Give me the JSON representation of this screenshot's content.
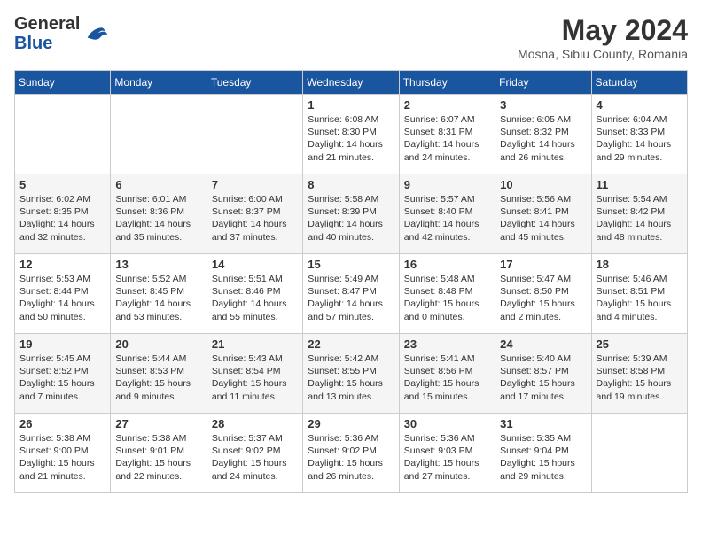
{
  "header": {
    "logo_general": "General",
    "logo_blue": "Blue",
    "month_year": "May 2024",
    "location": "Mosna, Sibiu County, Romania"
  },
  "weekdays": [
    "Sunday",
    "Monday",
    "Tuesday",
    "Wednesday",
    "Thursday",
    "Friday",
    "Saturday"
  ],
  "weeks": [
    [
      {
        "day": "",
        "info": ""
      },
      {
        "day": "",
        "info": ""
      },
      {
        "day": "",
        "info": ""
      },
      {
        "day": "1",
        "info": "Sunrise: 6:08 AM\nSunset: 8:30 PM\nDaylight: 14 hours\nand 21 minutes."
      },
      {
        "day": "2",
        "info": "Sunrise: 6:07 AM\nSunset: 8:31 PM\nDaylight: 14 hours\nand 24 minutes."
      },
      {
        "day": "3",
        "info": "Sunrise: 6:05 AM\nSunset: 8:32 PM\nDaylight: 14 hours\nand 26 minutes."
      },
      {
        "day": "4",
        "info": "Sunrise: 6:04 AM\nSunset: 8:33 PM\nDaylight: 14 hours\nand 29 minutes."
      }
    ],
    [
      {
        "day": "5",
        "info": "Sunrise: 6:02 AM\nSunset: 8:35 PM\nDaylight: 14 hours\nand 32 minutes."
      },
      {
        "day": "6",
        "info": "Sunrise: 6:01 AM\nSunset: 8:36 PM\nDaylight: 14 hours\nand 35 minutes."
      },
      {
        "day": "7",
        "info": "Sunrise: 6:00 AM\nSunset: 8:37 PM\nDaylight: 14 hours\nand 37 minutes."
      },
      {
        "day": "8",
        "info": "Sunrise: 5:58 AM\nSunset: 8:39 PM\nDaylight: 14 hours\nand 40 minutes."
      },
      {
        "day": "9",
        "info": "Sunrise: 5:57 AM\nSunset: 8:40 PM\nDaylight: 14 hours\nand 42 minutes."
      },
      {
        "day": "10",
        "info": "Sunrise: 5:56 AM\nSunset: 8:41 PM\nDaylight: 14 hours\nand 45 minutes."
      },
      {
        "day": "11",
        "info": "Sunrise: 5:54 AM\nSunset: 8:42 PM\nDaylight: 14 hours\nand 48 minutes."
      }
    ],
    [
      {
        "day": "12",
        "info": "Sunrise: 5:53 AM\nSunset: 8:44 PM\nDaylight: 14 hours\nand 50 minutes."
      },
      {
        "day": "13",
        "info": "Sunrise: 5:52 AM\nSunset: 8:45 PM\nDaylight: 14 hours\nand 53 minutes."
      },
      {
        "day": "14",
        "info": "Sunrise: 5:51 AM\nSunset: 8:46 PM\nDaylight: 14 hours\nand 55 minutes."
      },
      {
        "day": "15",
        "info": "Sunrise: 5:49 AM\nSunset: 8:47 PM\nDaylight: 14 hours\nand 57 minutes."
      },
      {
        "day": "16",
        "info": "Sunrise: 5:48 AM\nSunset: 8:48 PM\nDaylight: 15 hours\nand 0 minutes."
      },
      {
        "day": "17",
        "info": "Sunrise: 5:47 AM\nSunset: 8:50 PM\nDaylight: 15 hours\nand 2 minutes."
      },
      {
        "day": "18",
        "info": "Sunrise: 5:46 AM\nSunset: 8:51 PM\nDaylight: 15 hours\nand 4 minutes."
      }
    ],
    [
      {
        "day": "19",
        "info": "Sunrise: 5:45 AM\nSunset: 8:52 PM\nDaylight: 15 hours\nand 7 minutes."
      },
      {
        "day": "20",
        "info": "Sunrise: 5:44 AM\nSunset: 8:53 PM\nDaylight: 15 hours\nand 9 minutes."
      },
      {
        "day": "21",
        "info": "Sunrise: 5:43 AM\nSunset: 8:54 PM\nDaylight: 15 hours\nand 11 minutes."
      },
      {
        "day": "22",
        "info": "Sunrise: 5:42 AM\nSunset: 8:55 PM\nDaylight: 15 hours\nand 13 minutes."
      },
      {
        "day": "23",
        "info": "Sunrise: 5:41 AM\nSunset: 8:56 PM\nDaylight: 15 hours\nand 15 minutes."
      },
      {
        "day": "24",
        "info": "Sunrise: 5:40 AM\nSunset: 8:57 PM\nDaylight: 15 hours\nand 17 minutes."
      },
      {
        "day": "25",
        "info": "Sunrise: 5:39 AM\nSunset: 8:58 PM\nDaylight: 15 hours\nand 19 minutes."
      }
    ],
    [
      {
        "day": "26",
        "info": "Sunrise: 5:38 AM\nSunset: 9:00 PM\nDaylight: 15 hours\nand 21 minutes."
      },
      {
        "day": "27",
        "info": "Sunrise: 5:38 AM\nSunset: 9:01 PM\nDaylight: 15 hours\nand 22 minutes."
      },
      {
        "day": "28",
        "info": "Sunrise: 5:37 AM\nSunset: 9:02 PM\nDaylight: 15 hours\nand 24 minutes."
      },
      {
        "day": "29",
        "info": "Sunrise: 5:36 AM\nSunset: 9:02 PM\nDaylight: 15 hours\nand 26 minutes."
      },
      {
        "day": "30",
        "info": "Sunrise: 5:36 AM\nSunset: 9:03 PM\nDaylight: 15 hours\nand 27 minutes."
      },
      {
        "day": "31",
        "info": "Sunrise: 5:35 AM\nSunset: 9:04 PM\nDaylight: 15 hours\nand 29 minutes."
      },
      {
        "day": "",
        "info": ""
      }
    ]
  ]
}
